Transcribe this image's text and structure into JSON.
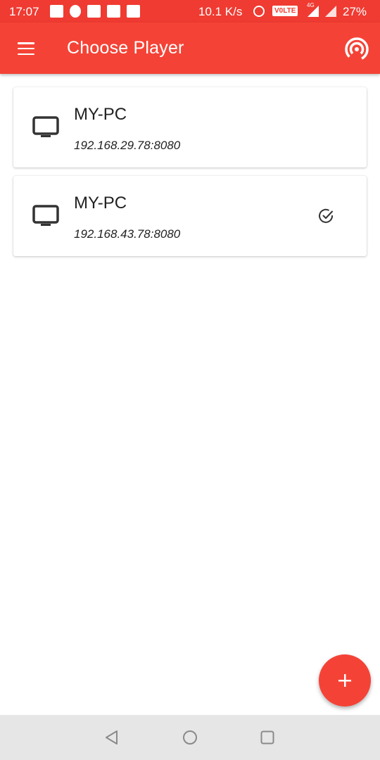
{
  "status_bar": {
    "time": "17:07",
    "speed": "10.1 K/s",
    "volte": "V0LTE",
    "network": "4G",
    "battery": "27%"
  },
  "app_bar": {
    "title": "Choose Player",
    "menu_icon": "hamburger-menu-icon",
    "cast_icon": "cast-broadcast-icon"
  },
  "players": [
    {
      "name": "MY-PC",
      "address": "192.168.29.78:8080",
      "selected": false,
      "icon": "tv-monitor-icon"
    },
    {
      "name": "MY-PC",
      "address": "192.168.43.78:8080",
      "selected": true,
      "icon": "tv-monitor-icon"
    }
  ],
  "fab": {
    "icon": "plus-icon",
    "label": "+"
  },
  "nav_bar": {
    "back_icon": "back-triangle-icon",
    "home_icon": "home-circle-icon",
    "recent_icon": "recent-square-icon"
  },
  "colors": {
    "primary": "#f44336",
    "status_bar": "#ef3b32",
    "nav_bar": "#e6e6e6"
  }
}
